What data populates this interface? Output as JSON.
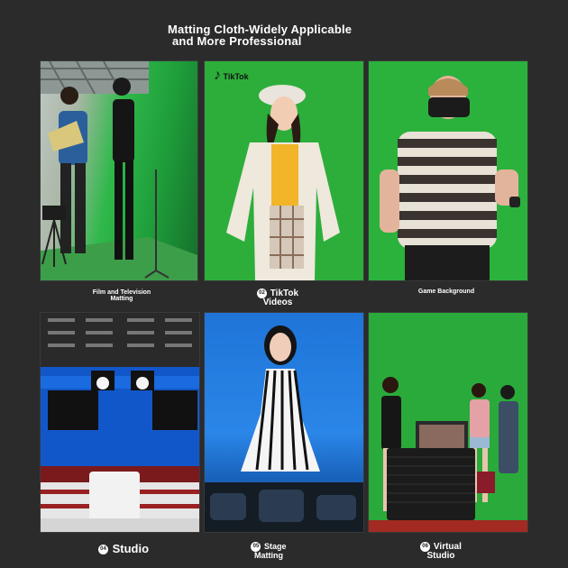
{
  "header": {
    "title_line1": "Matting Cloth-Widely Applicable",
    "title_line2": "and More Professional"
  },
  "tiles": [
    {
      "number": "",
      "label_line1": "Film and Television",
      "label_line2": "Matting"
    },
    {
      "number": "02",
      "label_line1": "TikTok",
      "label_line2": "Videos",
      "logo_text": "TikTok"
    },
    {
      "number": "",
      "label_line1": "Game Background",
      "label_line2": ""
    },
    {
      "number": "04",
      "label_line1": "Studio",
      "label_line2": ""
    },
    {
      "number": "05",
      "label_line1": "Stage",
      "label_line2": "Matting"
    },
    {
      "number": "06",
      "label_line1": "Virtual",
      "label_line2": "Studio"
    }
  ],
  "colors": {
    "background": "#2b2b2b",
    "chroma_green": "#2dae3b",
    "studio_blue": "#1f74d8"
  }
}
